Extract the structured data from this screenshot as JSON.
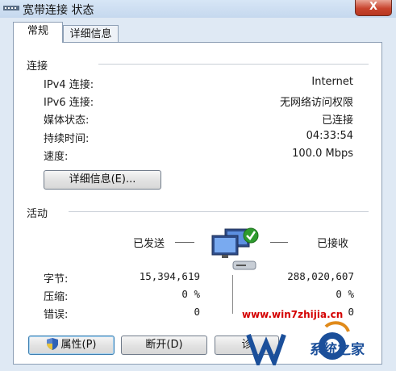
{
  "window": {
    "title": "宽带连接 状态",
    "close_label": "X"
  },
  "tabs": [
    {
      "label": "常规",
      "active": true
    },
    {
      "label": "详细信息",
      "active": false
    }
  ],
  "connection": {
    "section_label": "连接",
    "rows": [
      {
        "label": "IPv4 连接:",
        "value": "Internet"
      },
      {
        "label": "IPv6 连接:",
        "value": "无网络访问权限"
      },
      {
        "label": "媒体状态:",
        "value": "已连接"
      },
      {
        "label": "持续时间:",
        "value": "04:33:54"
      },
      {
        "label": "速度:",
        "value": "100.0 Mbps"
      }
    ],
    "details_button": "详细信息(E)..."
  },
  "activity": {
    "section_label": "活动",
    "sent_label": "已发送",
    "received_label": "已接收",
    "rows": [
      {
        "label": "字节:",
        "sent": "15,394,619",
        "received": "288,020,607"
      },
      {
        "label": "压缩:",
        "sent": "0 %",
        "received": "0 %"
      },
      {
        "label": "错误:",
        "sent": "0",
        "received": "0"
      }
    ]
  },
  "buttons": {
    "properties": "属性(P)",
    "disconnect": "断开(D)",
    "diagnose": "诊"
  },
  "watermark": {
    "url": "www.win7zhijia.cn",
    "brand": "系统之家"
  },
  "icons": {
    "title": "network-connection-icon",
    "activity": "network-computers-icon",
    "shield": "uac-shield-icon"
  },
  "colors": {
    "window_frame": "#dfe9f4",
    "close_button": "#c8442e",
    "watermark_red": "#d40000",
    "watermark_blue": "#1b4f9a"
  }
}
